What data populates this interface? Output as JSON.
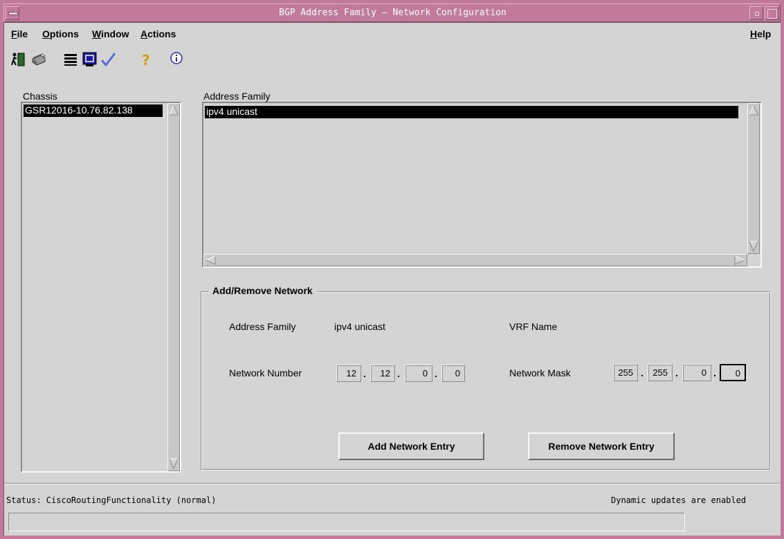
{
  "window": {
    "title": "BGP Address Family — Network Configuration"
  },
  "menubar": {
    "file": {
      "label": "File",
      "mnemonic": "F",
      "rest": "ile"
    },
    "options": {
      "label": "Options",
      "mnemonic": "O",
      "rest": "ptions"
    },
    "window": {
      "label": "Window",
      "mnemonic": "W",
      "rest": "indow"
    },
    "actions": {
      "label": "Actions",
      "mnemonic": "A",
      "rest": "ctions"
    },
    "help": {
      "label": "Help",
      "mnemonic": "H",
      "rest": "elp"
    }
  },
  "toolbar": {
    "icons": [
      "exit-icon",
      "print-icon",
      "list-icon",
      "monitor-icon",
      "checkmark-icon",
      "help-question-icon",
      "info-icon"
    ]
  },
  "chassis": {
    "label": "Chassis",
    "items": [
      "GSR12016-10.76.82.138"
    ],
    "selected_index": 0
  },
  "address_family_list": {
    "label": "Address Family",
    "items": [
      "ipv4 unicast"
    ],
    "selected_index": 0
  },
  "add_remove": {
    "title": "Add/Remove Network",
    "address_family_label": "Address Family",
    "address_family_value": "ipv4 unicast",
    "vrf_label": "VRF Name",
    "vrf_value": "",
    "network_number_label": "Network Number",
    "network_number": [
      "12",
      "12",
      "0",
      "0"
    ],
    "network_mask_label": "Network Mask",
    "network_mask": [
      "255",
      "255",
      "0",
      "0"
    ],
    "add_button": "Add Network Entry",
    "remove_button": "Remove Network Entry"
  },
  "statusbar": {
    "status": "Status: CiscoRoutingFunctionality (normal)",
    "updates": "Dynamic updates are enabled",
    "message": ""
  },
  "colors": {
    "title_bar": "#c27a9a",
    "background": "#d4d4d4",
    "selection": "#000000"
  }
}
